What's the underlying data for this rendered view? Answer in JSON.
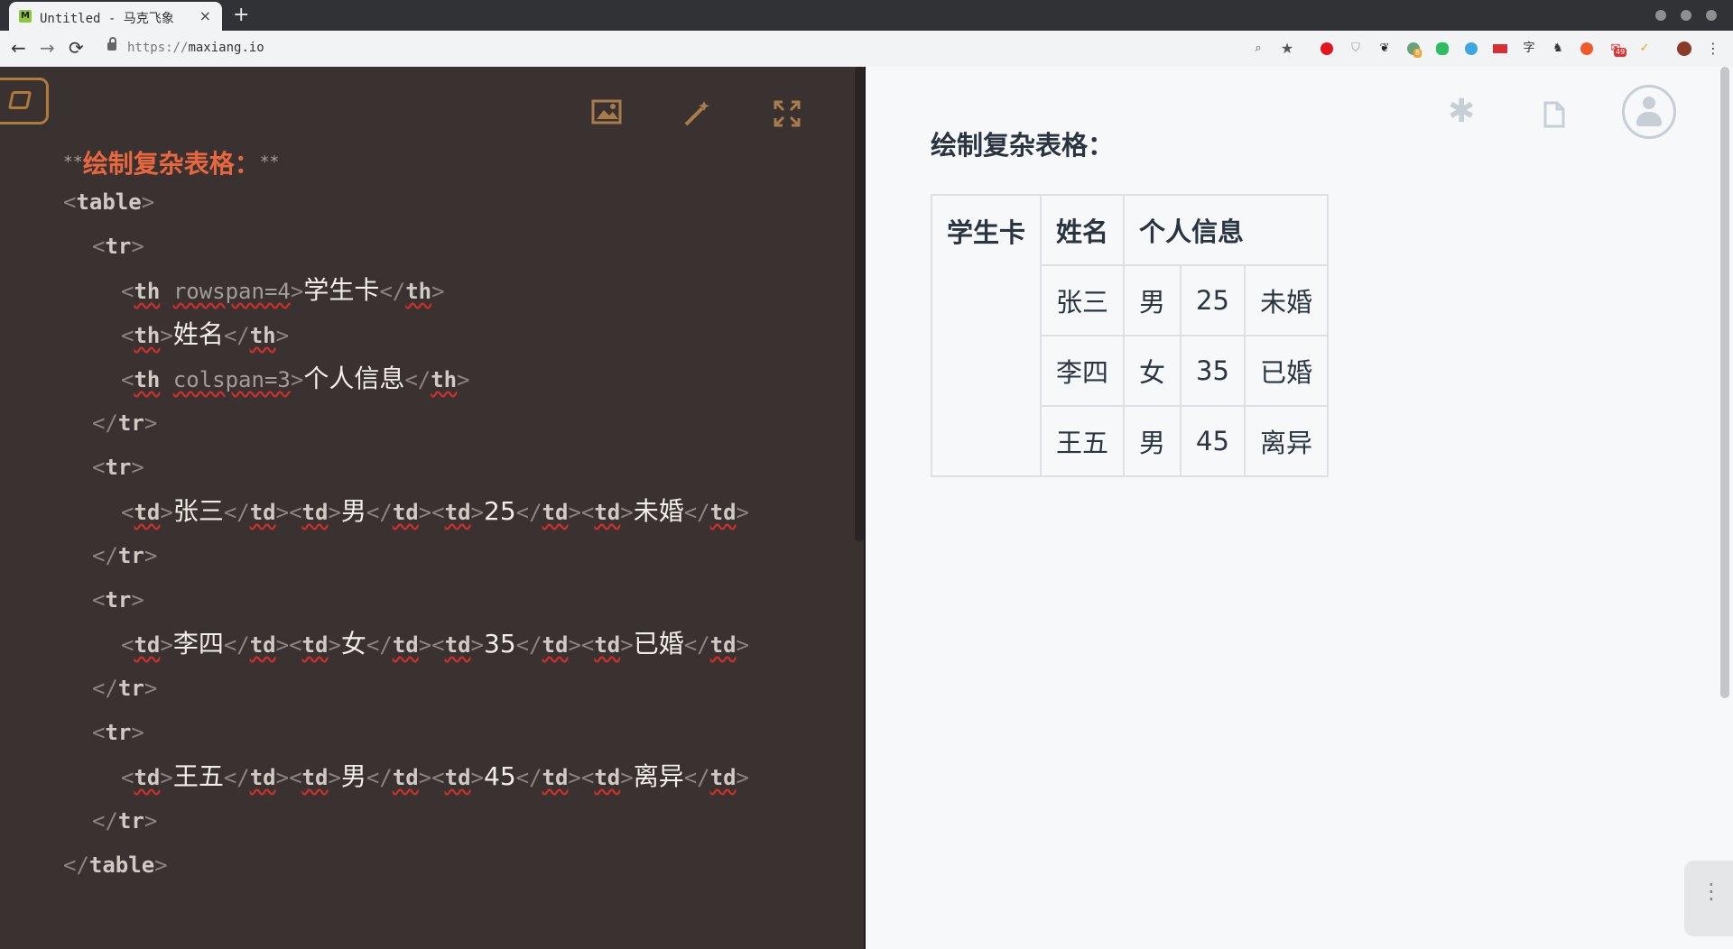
{
  "browser": {
    "tab_title": "Untitled - 马克飞象",
    "tab_favicon": "M",
    "tab_close": "×",
    "new_tab": "+",
    "url_scheme": "https://",
    "url_host": "maxiang.io",
    "nav": {
      "back": "←",
      "forward": "→",
      "reload": "⟳"
    },
    "toolbar_icons": [
      "zoom-icon",
      "bookmark-star-icon",
      "opera-icon",
      "shield-icon",
      "bird-icon",
      "extension-icon",
      "evernote-icon",
      "paint-icon",
      "counter-icon",
      "translate-icon",
      "fox-icon",
      "infinity-icon",
      "mail-icon",
      "check-icon",
      "profile-icon",
      "menu-icon"
    ],
    "translate_glyph": "字",
    "mail_badge": "49",
    "ext_badge": "8"
  },
  "editor": {
    "heading_md_open": "**",
    "heading_text": "绘制复杂表格：",
    "heading_md_close": "**",
    "row1": [
      "学生卡"
    ],
    "th_name": "姓名",
    "th_info": "个人信息",
    "rowspan_attr": "rowspan=4",
    "colspan_attr": "colspan=3",
    "tag_table": "table",
    "tag_tr": "tr",
    "tag_th": "th",
    "tag_td": "td",
    "rows": [
      [
        "张三",
        "男",
        "25",
        "未婚"
      ],
      [
        "李四",
        "女",
        "35",
        "已婚"
      ],
      [
        "王五",
        "男",
        "45",
        "离异"
      ]
    ]
  },
  "preview": {
    "title": "绘制复杂表格：",
    "table": {
      "header_card": "学生卡",
      "header_name": "姓名",
      "header_info": "个人信息",
      "rows": [
        [
          "张三",
          "男",
          "25",
          "未婚"
        ],
        [
          "李四",
          "女",
          "35",
          "已婚"
        ],
        [
          "王五",
          "男",
          "45",
          "离异"
        ]
      ]
    }
  }
}
